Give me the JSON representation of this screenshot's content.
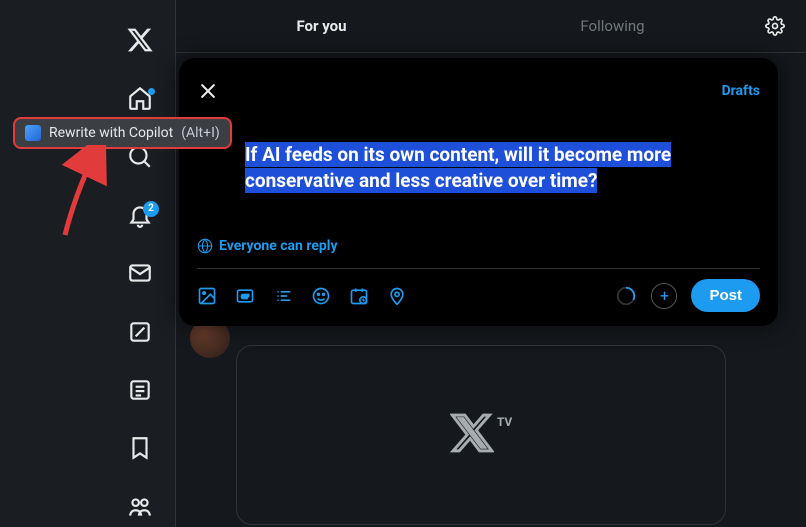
{
  "tabs": {
    "for_you": "For you",
    "following": "Following"
  },
  "compose": {
    "drafts": "Drafts",
    "text": "If AI feeds on its own content, will it become more conservative and less creative over time?",
    "reply_label": "Everyone can reply",
    "post_label": "Post"
  },
  "nav": {
    "notification_count": "2"
  },
  "feed": {
    "xtv_label": "TV"
  },
  "copilot": {
    "label": "Rewrite with Copilot",
    "shortcut": "(Alt+I)"
  }
}
